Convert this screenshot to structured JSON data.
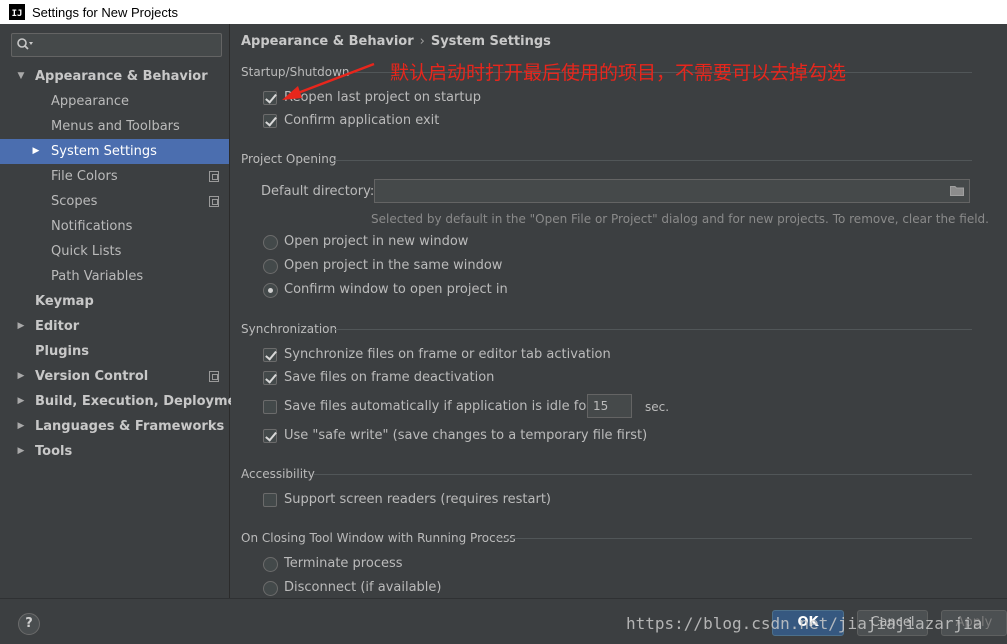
{
  "window": {
    "title": "Settings for New Projects",
    "app_icon_text": "IJ"
  },
  "search": {
    "placeholder": ""
  },
  "sidebar": {
    "items": [
      {
        "label": "Appearance & Behavior",
        "arrow": "▼",
        "bold": true
      },
      {
        "label": "Appearance"
      },
      {
        "label": "Menus and Toolbars"
      },
      {
        "label": "System Settings",
        "arrow": "▶",
        "selected": true
      },
      {
        "label": "File Colors",
        "project_icon": true
      },
      {
        "label": "Scopes",
        "project_icon": true
      },
      {
        "label": "Notifications"
      },
      {
        "label": "Quick Lists"
      },
      {
        "label": "Path Variables"
      },
      {
        "label": "Keymap",
        "bold": true
      },
      {
        "label": "Editor",
        "arrow": "▶",
        "bold": true
      },
      {
        "label": "Plugins",
        "bold": true
      },
      {
        "label": "Version Control",
        "arrow": "▶",
        "bold": true,
        "project_icon": true
      },
      {
        "label": "Build, Execution, Deployment",
        "arrow": "▶",
        "bold": true
      },
      {
        "label": "Languages & Frameworks",
        "arrow": "▶",
        "bold": true
      },
      {
        "label": "Tools",
        "arrow": "▶",
        "bold": true
      }
    ]
  },
  "breadcrumb": {
    "parent": "Appearance & Behavior",
    "separator": "›",
    "current": "System Settings"
  },
  "startup": {
    "title": "Startup/Shutdown",
    "reopen_label": "Reopen last project on startup",
    "confirm_exit_label": "Confirm application exit"
  },
  "project_opening": {
    "title": "Project Opening",
    "default_dir_label": "Default directory:",
    "default_dir_value": "",
    "hint": "Selected by default in the \"Open File or Project\" dialog and for new projects. To remove, clear the field.",
    "radio_new_window": "Open project in new window",
    "radio_same_window": "Open project in the same window",
    "radio_confirm": "Confirm window to open project in"
  },
  "synchronization": {
    "title": "Synchronization",
    "sync_files_label": "Synchronize files on frame or editor tab activation",
    "save_on_deactivation_label": "Save files on frame deactivation",
    "save_idle_label": "Save files automatically if application is idle for",
    "idle_seconds": "15",
    "idle_unit": "sec.",
    "safe_write_label": "Use \"safe write\" (save changes to a temporary file first)"
  },
  "accessibility": {
    "title": "Accessibility",
    "screen_readers_label": "Support screen readers (requires restart)"
  },
  "closing_tool_window": {
    "title": "On Closing Tool Window with Running Process",
    "terminate_label": "Terminate process",
    "disconnect_label": "Disconnect (if available)"
  },
  "annotation": {
    "text": "默认启动时打开最后使用的项目，不需要可以去掉勾选",
    "color": "#e8261c"
  },
  "footer": {
    "help_label": "?",
    "ok_label": "OK",
    "cancel_label": "Cancel",
    "apply_label": "Apply"
  },
  "watermark": "https://blog.csdn.net/jiajiajiazarjia",
  "colors": {
    "accent": "#4b6eaf",
    "ok_button": "#365880",
    "background": "#3c3f41"
  }
}
